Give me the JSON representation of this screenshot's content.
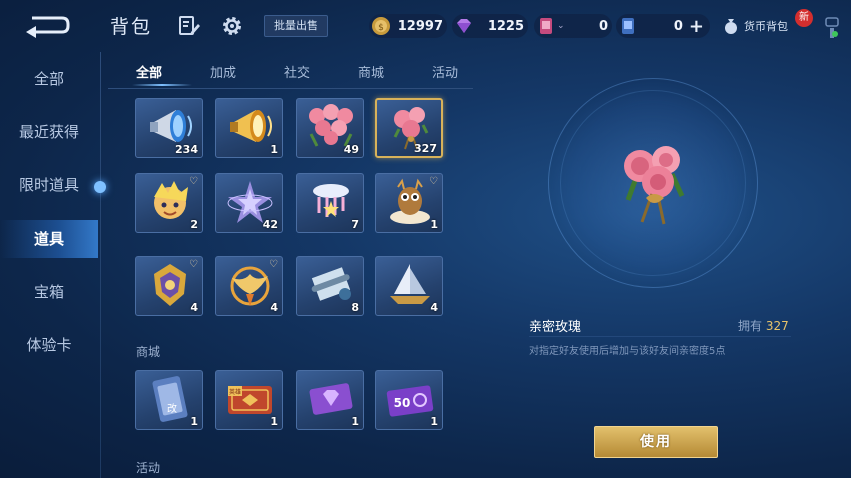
{
  "header": {
    "title": "背包",
    "bulk_sell_label": "批量出售",
    "currency_bag_label": "货币背包",
    "new_badge": "新"
  },
  "currencies": [
    {
      "icon": "gold-coin-icon",
      "value": "12997"
    },
    {
      "icon": "diamond-icon",
      "value": "1225"
    },
    {
      "icon": "ticket-card-icon",
      "value": "0"
    },
    {
      "icon": "coupon-card-icon",
      "value": "0"
    }
  ],
  "sidebar": {
    "items": [
      {
        "label": "全部"
      },
      {
        "label": "最近获得"
      },
      {
        "label": "限时道具"
      },
      {
        "label": "道具"
      },
      {
        "label": "宝箱"
      },
      {
        "label": "体验卡"
      }
    ],
    "active_index": 3
  },
  "tabs": {
    "items": [
      {
        "label": "全部"
      },
      {
        "label": "加成"
      },
      {
        "label": "社交"
      },
      {
        "label": "商城"
      },
      {
        "label": "活动"
      }
    ],
    "active_index": 0
  },
  "sections": {
    "shop": "商城",
    "event": "活动"
  },
  "items": {
    "row1": [
      {
        "icon": "blue-megaphone-icon",
        "count": "234"
      },
      {
        "icon": "gold-megaphone-icon",
        "count": "1"
      },
      {
        "icon": "rose-bouquet-icon",
        "count": "49"
      },
      {
        "icon": "rose-bouquet-small-icon",
        "count": "327"
      }
    ],
    "row2": [
      {
        "icon": "hero-avatar-icon",
        "count": "2"
      },
      {
        "icon": "star-charm-icon",
        "count": "42"
      },
      {
        "icon": "rainbow-cloud-icon",
        "count": "7"
      },
      {
        "icon": "owl-cloud-icon",
        "count": "1"
      }
    ],
    "row3": [
      {
        "icon": "gold-emblem-icon",
        "count": "4"
      },
      {
        "icon": "phoenix-emblem-icon",
        "count": "4"
      },
      {
        "icon": "scroll-icon",
        "count": "8"
      },
      {
        "icon": "paper-boat-icon",
        "count": "4"
      }
    ],
    "shop": [
      {
        "icon": "rename-card-icon",
        "count": "1",
        "card_text": "改"
      },
      {
        "icon": "hero-ticket-icon",
        "count": "1",
        "card_text": "英雄"
      },
      {
        "icon": "purple-diamond-ticket-icon",
        "count": "1"
      },
      {
        "icon": "discount-ticket-icon",
        "count": "1",
        "card_text": "50"
      }
    ]
  },
  "detail": {
    "name": "亲密玫瑰",
    "own_label": "拥有",
    "own_count": "327",
    "description": "对指定好友使用后增加与该好友间亲密度5点",
    "use_label": "使用"
  },
  "colors": {
    "accent_gold": "#d8b25a",
    "button_gold": "#e2c06c",
    "own_count": "#e7c36b",
    "badge_red": "#d42e2e"
  }
}
